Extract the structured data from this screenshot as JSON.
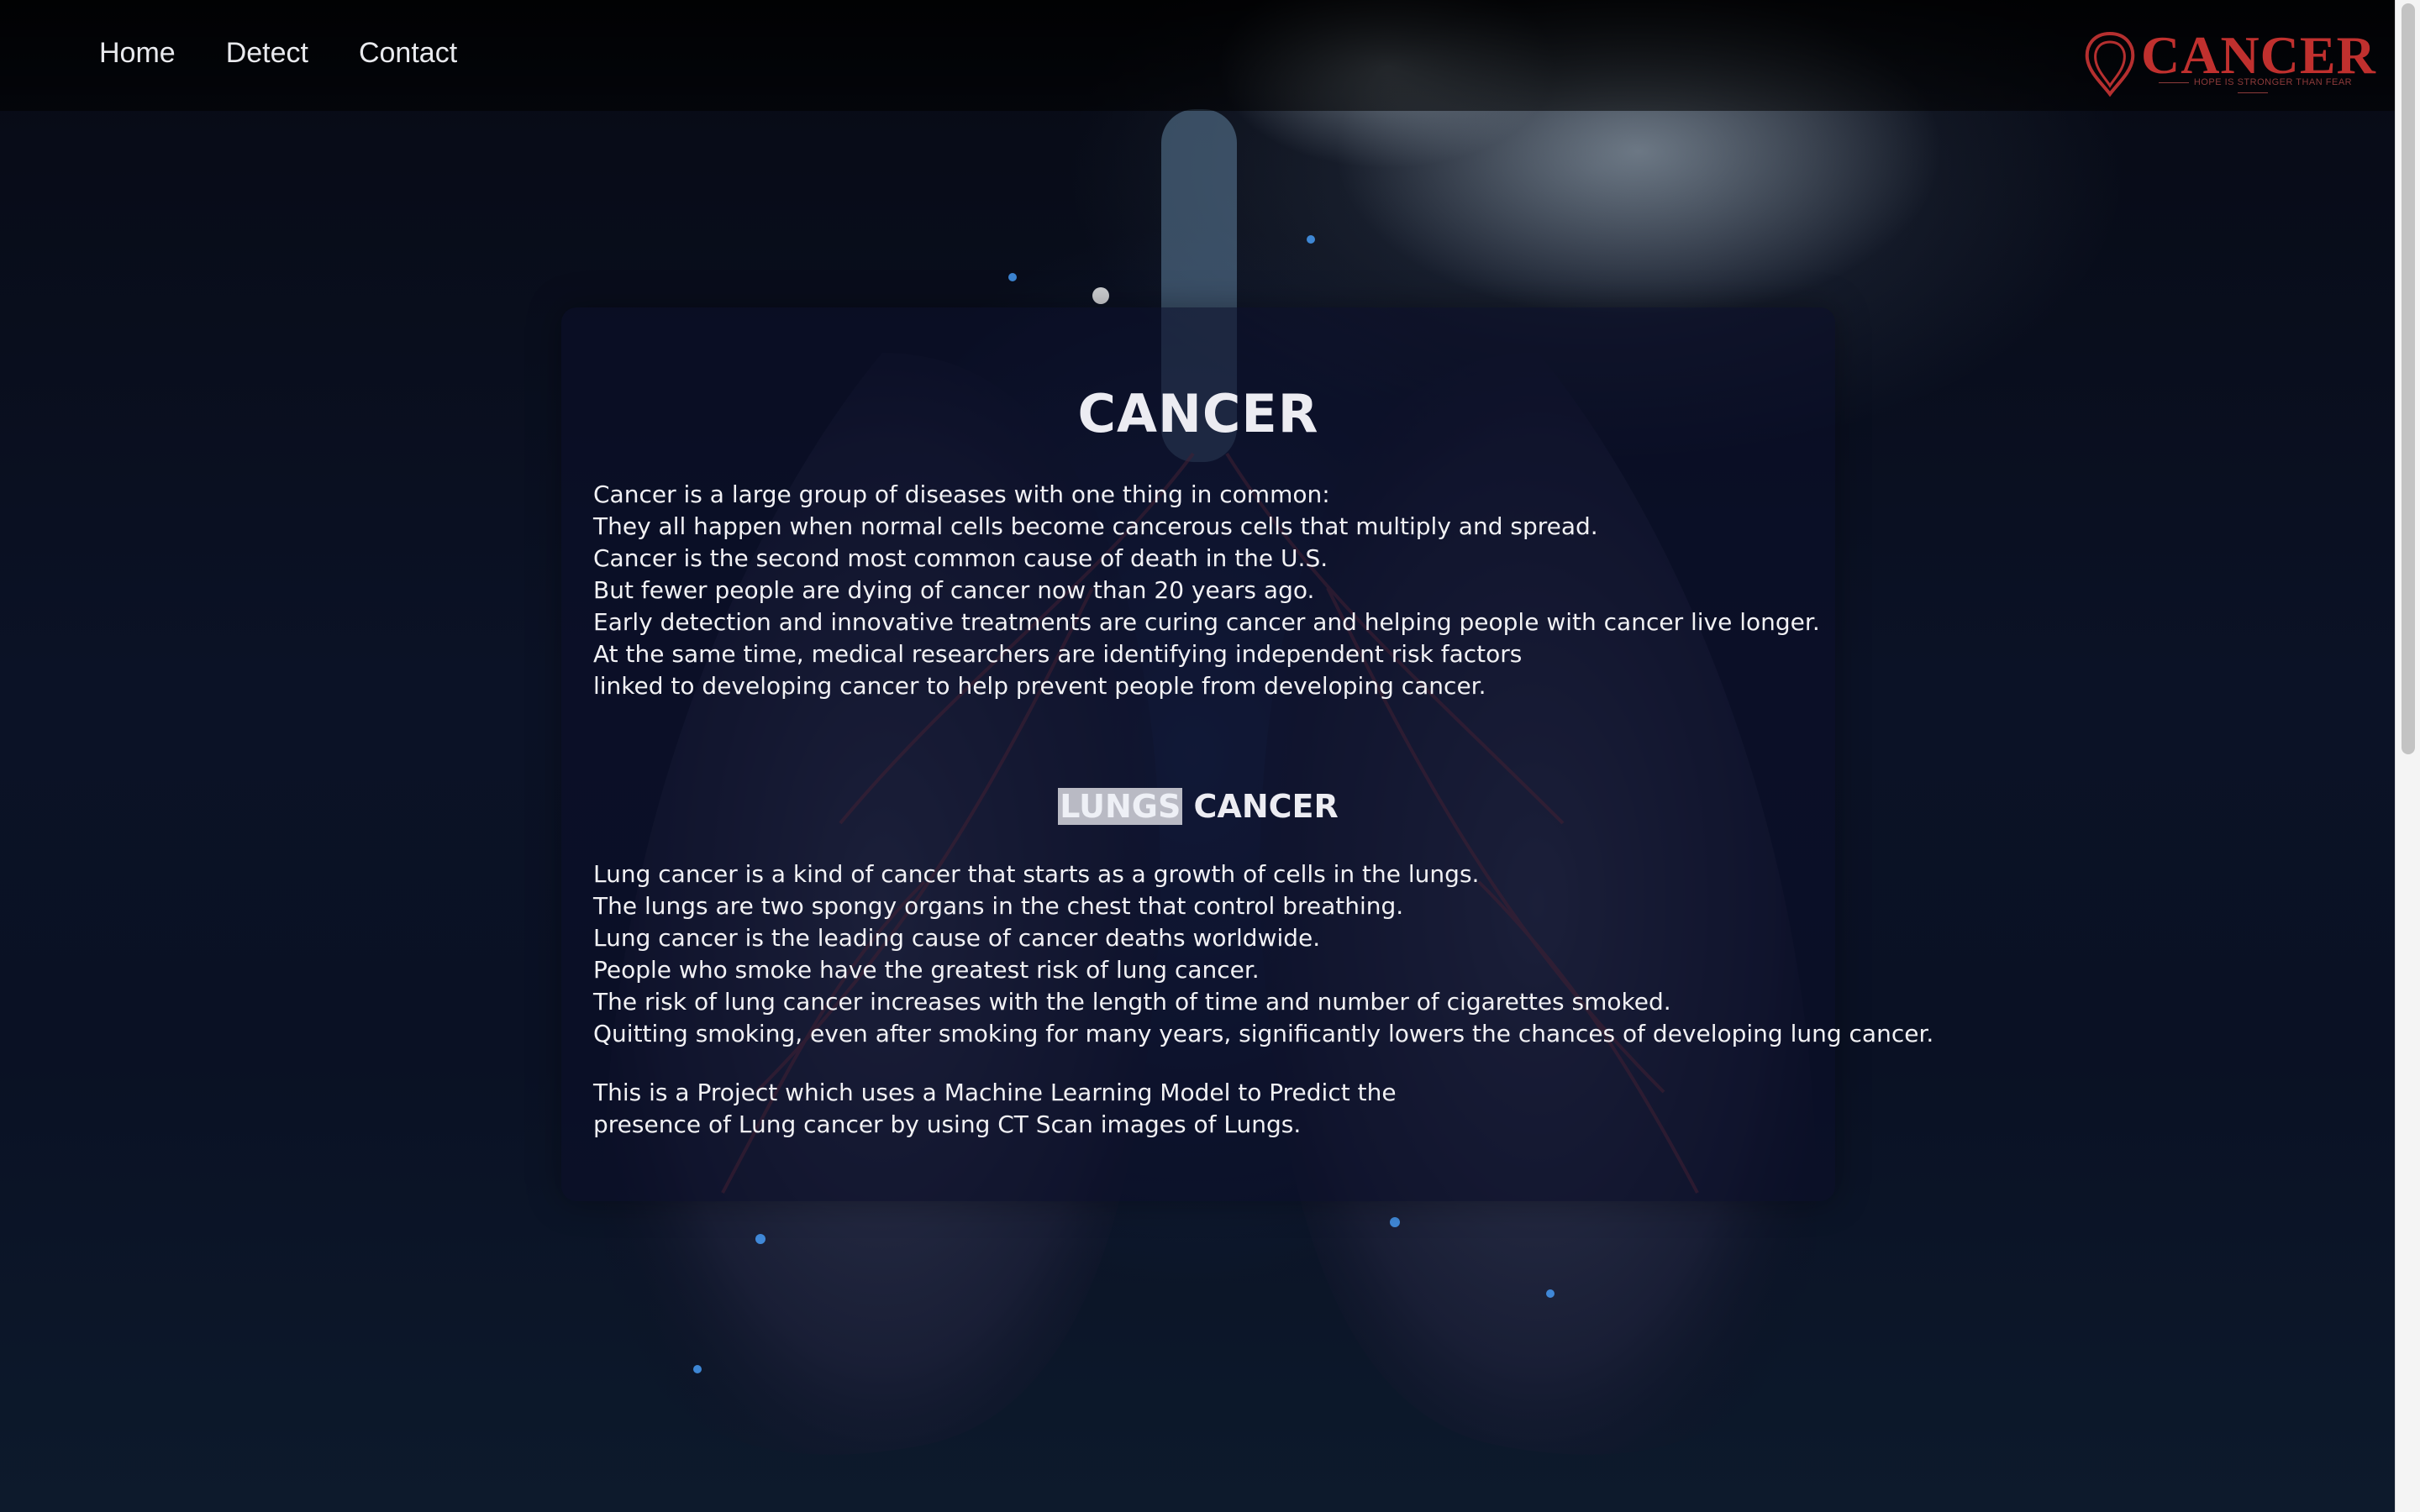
{
  "nav": {
    "links": [
      "Home",
      "Detect",
      "Contact"
    ]
  },
  "logo": {
    "text": "CANCER",
    "tagline": "HOPE IS STRONGER THAN FEAR",
    "color": "#c0302e"
  },
  "card": {
    "title": "CANCER",
    "intro_lines": [
      "Cancer is a large group of diseases with one thing in common:",
      "They all happen when normal cells become cancerous cells that multiply and spread.",
      "Cancer is the second most common cause of death in the U.S.",
      "But fewer people are dying of cancer now than 20 years ago.",
      "Early detection and innovative treatments are curing cancer and helping people with cancer live longer.",
      "At the same time, medical researchers are identifying independent risk factors",
      "linked to developing cancer to help prevent people from developing cancer."
    ],
    "subtitle_highlight": "LUNGS",
    "subtitle_rest": "CANCER",
    "lung_lines": [
      "Lung cancer is a kind of cancer that starts as a growth of cells in the lungs.",
      "The lungs are two spongy organs in the chest that control breathing.",
      "Lung cancer is the leading cause of cancer deaths worldwide.",
      "People who smoke have the greatest risk of lung cancer.",
      "The risk of lung cancer increases with the length of time and number of cigarettes smoked.",
      "Quitting smoking, even after smoking for many years, significantly lowers the chances of developing lung cancer."
    ],
    "project_lines": [
      "This is a Project which uses a Machine Learning Model to Predict the",
      "presence of Lung cancer by using CT Scan images of Lungs."
    ]
  }
}
